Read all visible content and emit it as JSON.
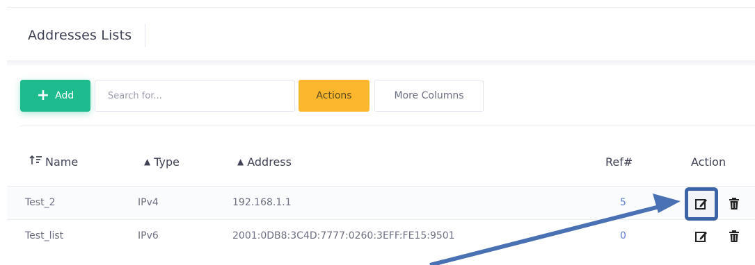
{
  "page": {
    "title": "Addresses Lists"
  },
  "toolbar": {
    "add_label": "Add",
    "search_placeholder": "Search for...",
    "actions_label": "Actions",
    "more_columns_label": "More Columns"
  },
  "table": {
    "headers": {
      "name": "Name",
      "type": "Type",
      "address": "Address",
      "ref": "Ref#",
      "action": "Action"
    },
    "rows": [
      {
        "name": "Test_2",
        "type": "IPv4",
        "address": "192.168.1.1",
        "ref": "5"
      },
      {
        "name": "Test_list",
        "type": "IPv6",
        "address": "2001:0DB8:3C4D:7777:0260:3EFF:FE15:9501",
        "ref": "0"
      }
    ]
  },
  "annotation": {
    "highlight_color": "#3b63a6",
    "arrow_color": "#4a71b3"
  },
  "colors": {
    "add": "#1dbb8d",
    "actions": "#fcb72e",
    "ref_link": "#5b7ad6"
  },
  "icons": [
    "plus-icon",
    "sort-desc-icon",
    "sort-icon",
    "edit-icon",
    "trash-icon"
  ]
}
